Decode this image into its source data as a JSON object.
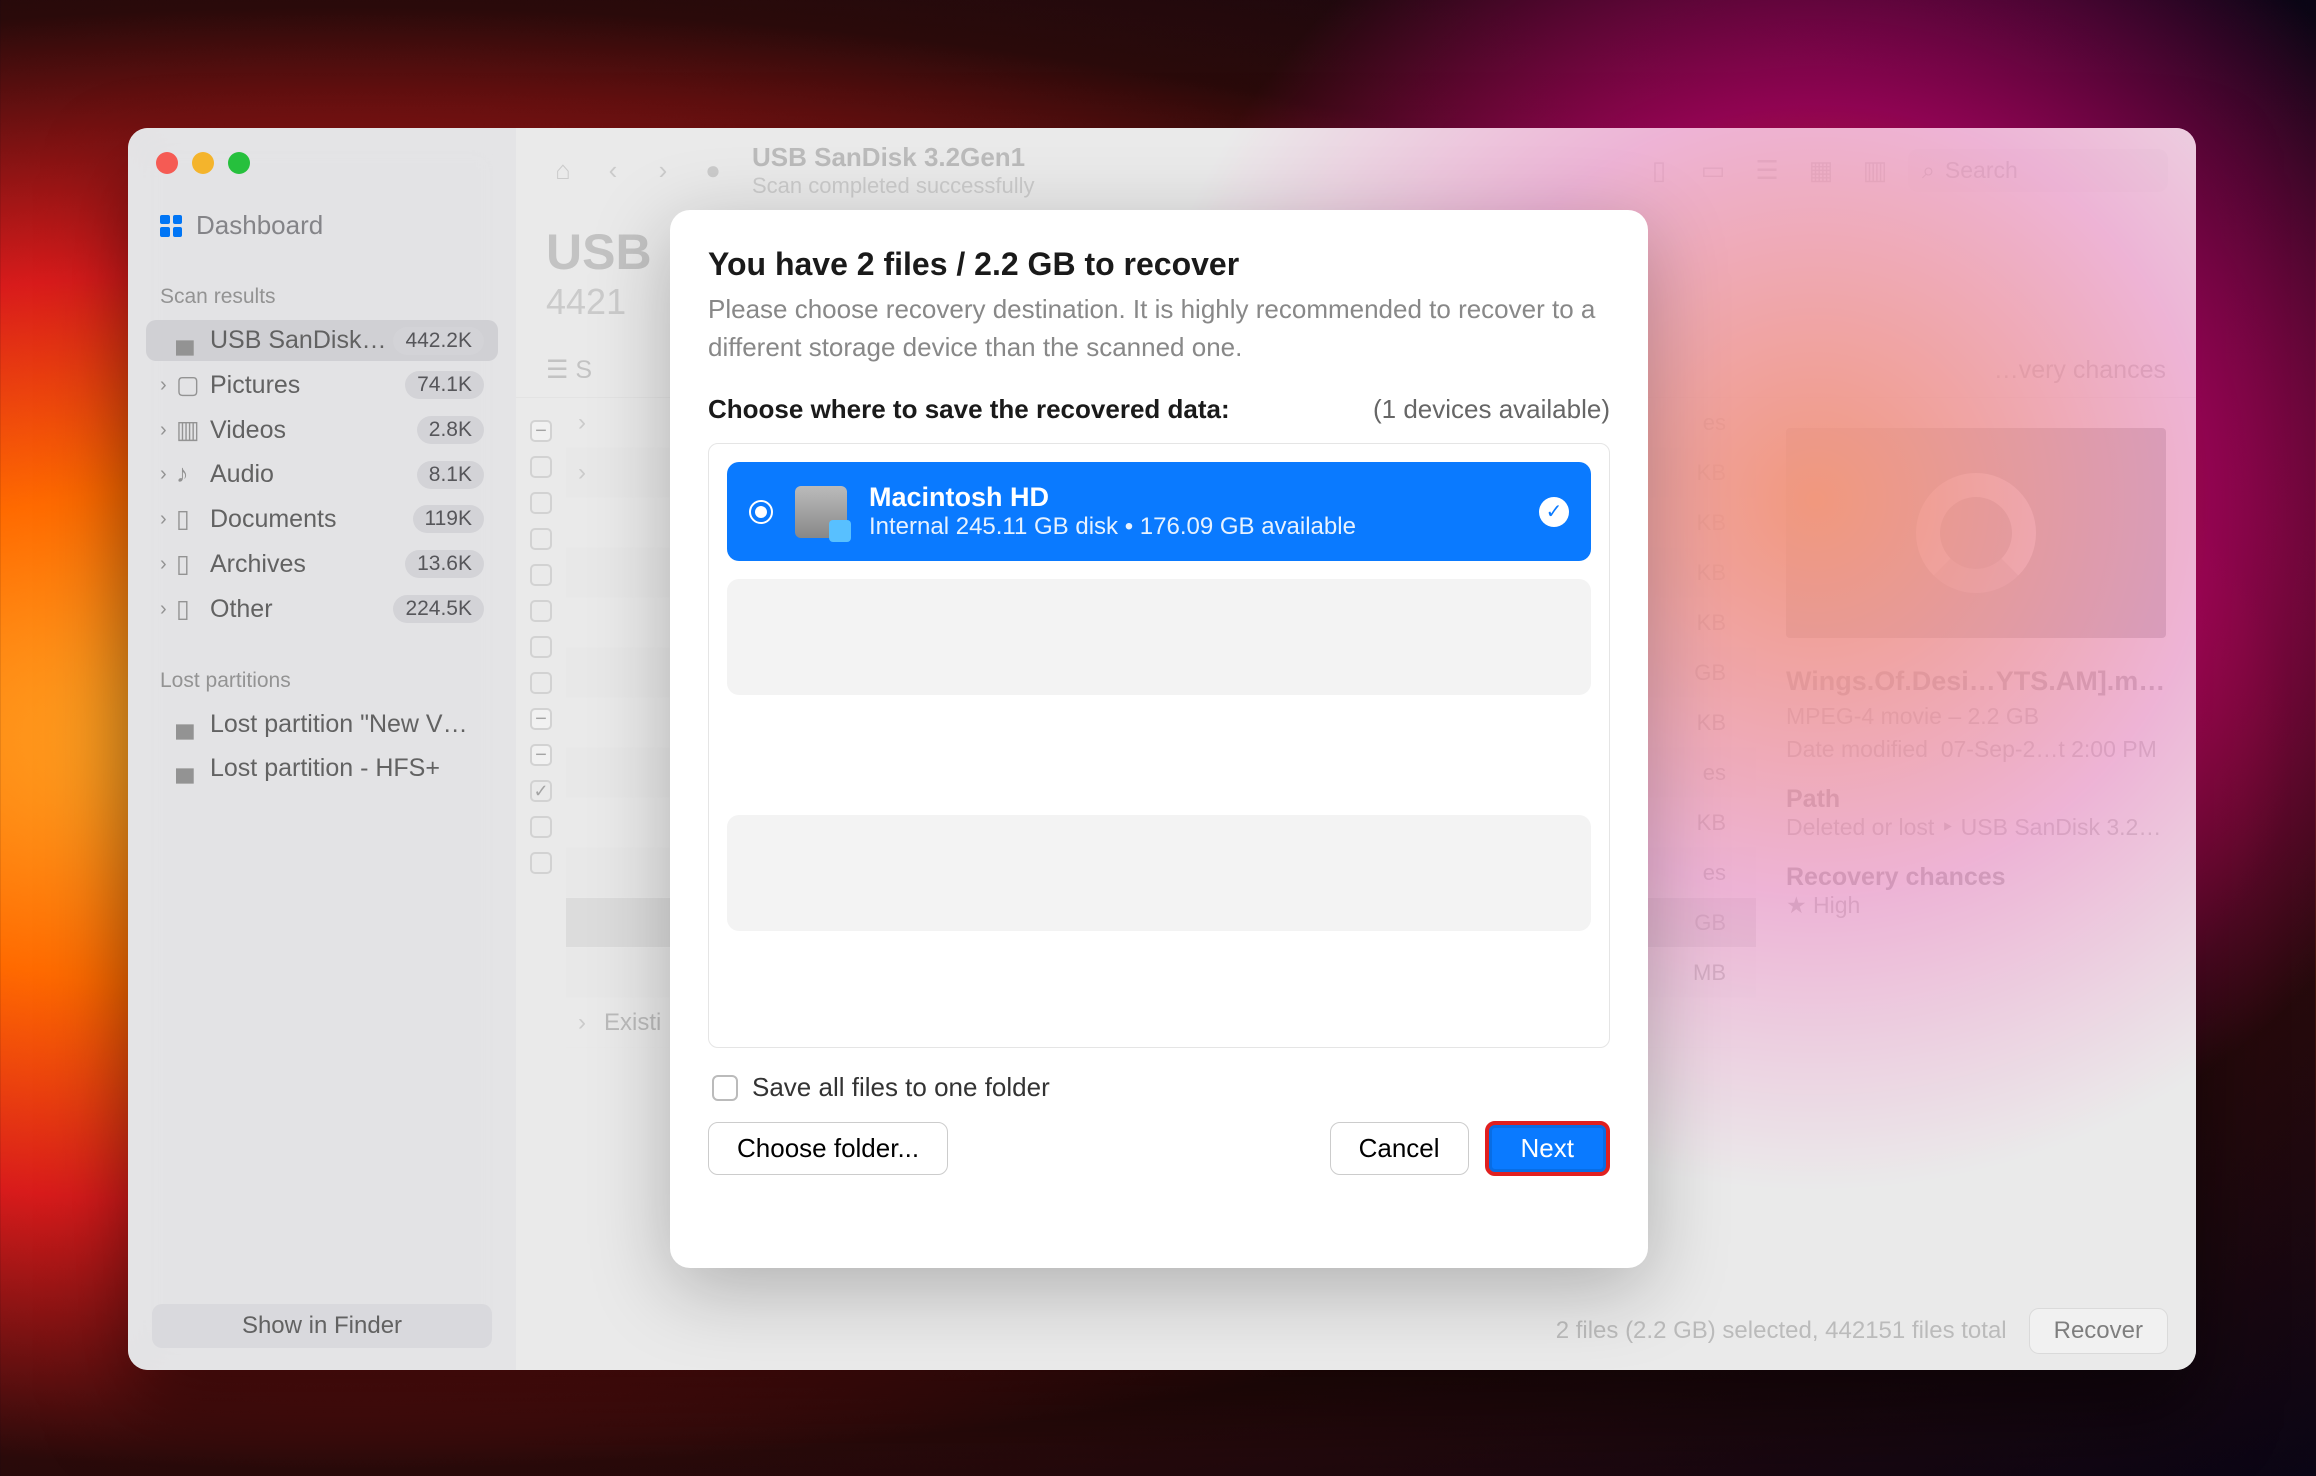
{
  "window": {
    "title": "USB  SanDisk 3.2Gen1",
    "subtitle": "Scan completed successfully",
    "search_placeholder": "Search",
    "heading_cut": "USB",
    "count_cut": "4421"
  },
  "sidebar": {
    "dashboard": "Dashboard",
    "scan_results_label": "Scan results",
    "lost_partitions_label": "Lost partitions",
    "show_in_finder": "Show in Finder",
    "items": [
      {
        "icon": "disk",
        "label": "USB  SanDisk…",
        "badge": "442.2K",
        "active": true,
        "chev": false
      },
      {
        "icon": "picture",
        "label": "Pictures",
        "badge": "74.1K",
        "chev": true
      },
      {
        "icon": "video",
        "label": "Videos",
        "badge": "2.8K",
        "chev": true
      },
      {
        "icon": "audio",
        "label": "Audio",
        "badge": "8.1K",
        "chev": true
      },
      {
        "icon": "document",
        "label": "Documents",
        "badge": "119K",
        "chev": true
      },
      {
        "icon": "archive",
        "label": "Archives",
        "badge": "13.6K",
        "chev": true
      },
      {
        "icon": "other",
        "label": "Other",
        "badge": "224.5K",
        "chev": true
      }
    ],
    "lost": [
      {
        "label": "Lost partition \"New V…"
      },
      {
        "label": "Lost partition - HFS+"
      }
    ]
  },
  "toolbar": {
    "recovery_chances": "…very chances"
  },
  "filelist_row": {
    "existing": "Existi",
    "kb": "KB",
    "gb": "GB",
    "mb": "MB",
    "es": "es"
  },
  "preview": {
    "filename": "Wings.Of.Desi…YTS.AM].mp4",
    "meta": "MPEG-4 movie – 2.2 GB",
    "modified_label": "Date modified",
    "modified_value": "07-Sep-2…t 2:00 PM",
    "path_label": "Path",
    "path_value": "Deleted or lost ‣ USB  SanDisk 3.2…",
    "recovery_label": "Recovery chances",
    "recovery_value": "High"
  },
  "statusbar": {
    "text": "2 files (2.2 GB) selected, 442151 files total",
    "recover": "Recover"
  },
  "modal": {
    "title": "You have 2 files / 2.2 GB to recover",
    "description": "Please choose recovery destination. It is highly recommended to recover to a different storage device than the scanned one.",
    "choose_label": "Choose where to save the recovered data:",
    "devices_available": "(1 devices available)",
    "device": {
      "name": "Macintosh HD",
      "detail": "Internal 245.11 GB disk • 176.09 GB available"
    },
    "save_all": "Save all files to one folder",
    "choose_folder": "Choose folder...",
    "cancel": "Cancel",
    "next": "Next"
  }
}
